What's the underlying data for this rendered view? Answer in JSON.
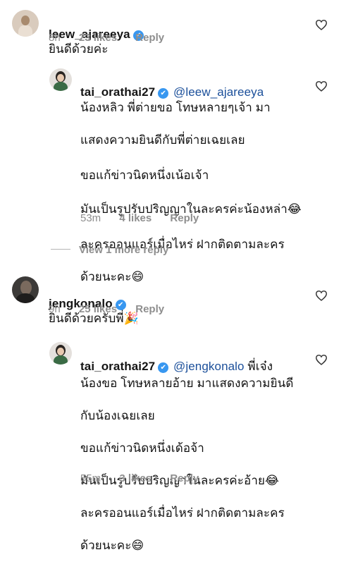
{
  "comments": [
    {
      "username": "leew_ajareeya",
      "text": "ยินดีด้วยค่ะ",
      "time": "8h",
      "likes": "23 likes",
      "reply": "Reply"
    },
    {
      "username": "tai_orathai27",
      "mention": "@leew_ajareeya",
      "lines": [
        "น้องหลิว พี่ต่ายขอ โทษหลายๆเจ้า มา",
        "แสดงความยินดีกับพี่ต่ายเฉยเลย",
        "ขอแก้ข่าวนิดหนึ่งเน้อเจ้า",
        "มันเป็นรูปรับปริญญาในละครค่ะน้องหล่า😂",
        "ละครออนแอร์เมื่อไหร่ ฝากติดตามละคร",
        "ด้วยนะคะ😄"
      ],
      "time": "53m",
      "likes": "4 likes",
      "reply": "Reply"
    },
    {
      "username": "jengkonalo",
      "text": "ยินดีด้วยครับพี่🎉",
      "time": "9h",
      "likes": "25 likes",
      "reply": "Reply"
    },
    {
      "username": "tai_orathai27",
      "mention": "@jengkonalo",
      "first_suffix": " พี่เจ๋ง",
      "lines": [
        "น้องขอ โทษหลายอ้าย มาแสดงความยินดี",
        "กับน้องเฉยเลย",
        "ขอแก้ข่าวนิดหนึ่งเด้อจ้า",
        "มันเป็นรูปรับปริญญาในละครค่ะอ้าย😂",
        "ละครออนแอร์เมื่อไหร่ ฝากติดตามละคร",
        "ด้วยนะคะ😄"
      ],
      "time": "55m",
      "likes": "3 likes",
      "reply": "Reply"
    }
  ],
  "view_more": "View 1 more reply",
  "icons": {
    "verified": "verified-badge-icon",
    "like": "heart-outline-icon"
  },
  "colors": {
    "mention": "#1b4f9a",
    "verified": "#3897f0",
    "meta": "#8e8e8e"
  }
}
